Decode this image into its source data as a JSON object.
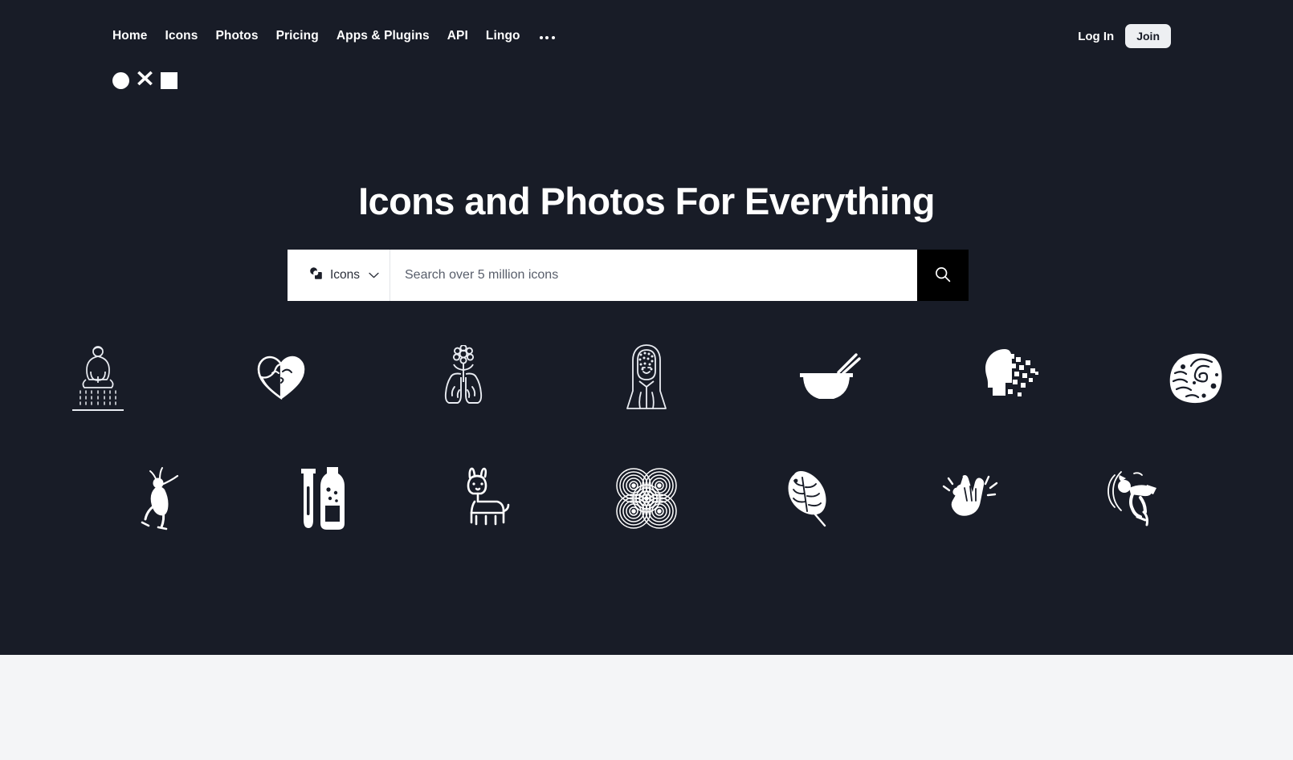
{
  "site": {
    "background_color": "#181C27",
    "lower_background_color": "#F4F5F7",
    "accent_color": "#000000"
  },
  "nav": {
    "items": [
      {
        "label": "Home",
        "name": "nav-link-home"
      },
      {
        "label": "Icons",
        "name": "nav-link-icons"
      },
      {
        "label": "Photos",
        "name": "nav-link-photos"
      },
      {
        "label": "Pricing",
        "name": "nav-link-pricing"
      },
      {
        "label": "Apps & Plugins",
        "name": "nav-link-apps-plugins"
      },
      {
        "label": "API",
        "name": "nav-link-api"
      },
      {
        "label": "Lingo",
        "name": "nav-link-lingo"
      }
    ],
    "overflow_icon": "ellipsis-icon",
    "login_label": "Log In",
    "join_label": "Join"
  },
  "logo": {
    "name": "noun-project-logo",
    "shapes": [
      "circle",
      "x",
      "square"
    ],
    "color": "#FFFFFF"
  },
  "hero": {
    "headline": "Icons and Photos For Everything"
  },
  "search": {
    "type_label": "Icons",
    "type_icon": "noun-project-mark-icon",
    "chevron_icon": "chevron-down-icon",
    "placeholder": "Search over 5 million icons",
    "value": "",
    "button_icon": "search-icon"
  },
  "icon_grid": {
    "row1": [
      {
        "name": "icon-meditating-buddha-shower",
        "label": "meditating buddha"
      },
      {
        "name": "icon-heart-two-faces",
        "label": "heart with faces"
      },
      {
        "name": "icon-lungs-flower",
        "label": "lungs with flower"
      },
      {
        "name": "icon-woman-long-hair",
        "label": "woman portrait"
      },
      {
        "name": "icon-noodle-bowl-chopsticks",
        "label": "noodle bowl"
      },
      {
        "name": "icon-pixelated-head",
        "label": "pixelated head"
      },
      {
        "name": "icon-brain-spiral-blob",
        "label": "brain spiral"
      }
    ],
    "row2": [
      {
        "name": "icon-dancing-figure",
        "label": "dancing figure"
      },
      {
        "name": "icon-test-tube-bottle",
        "label": "test tube and bottle"
      },
      {
        "name": "icon-llama",
        "label": "llama"
      },
      {
        "name": "icon-concentric-spirals",
        "label": "concentric spirals"
      },
      {
        "name": "icon-monstera-leaf",
        "label": "monstera leaf"
      },
      {
        "name": "icon-clapping-hands",
        "label": "clapping hands"
      },
      {
        "name": "icon-breakdancer",
        "label": "breakdancer"
      }
    ]
  }
}
